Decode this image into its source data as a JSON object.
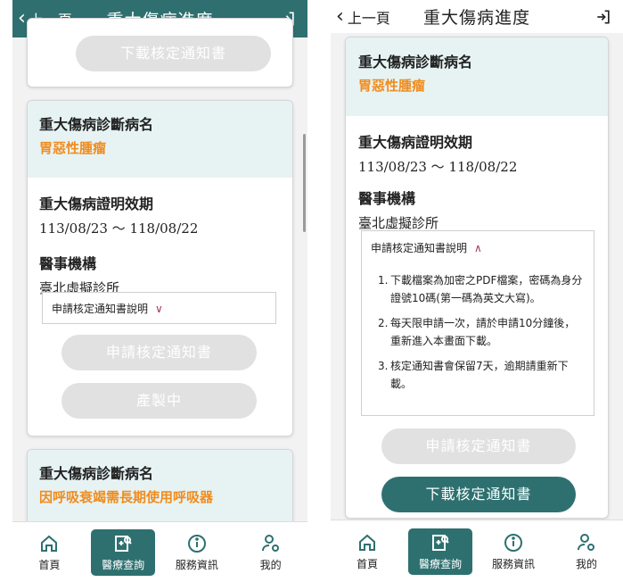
{
  "header": {
    "back_label": "上一頁",
    "title": "重大傷病進度"
  },
  "labels": {
    "diag_label": "重大傷病診斷病名",
    "valid_label": "重大傷病證明效期",
    "hospital_label": "醫事機構"
  },
  "left": {
    "top_button": "下載核定通知書",
    "card2": {
      "diagnosis": "胃惡性腫瘤",
      "valid_period": "113/08/23 ～ 118/08/22",
      "hospital": "臺北虛擬診所",
      "explain_toggle": "申請核定通知書說明",
      "apply_button": "申請核定通知書",
      "producing_button": "產製中"
    },
    "card3": {
      "diagnosis": "因呼吸衰竭需長期使用呼吸器"
    }
  },
  "right": {
    "card": {
      "diagnosis": "胃惡性腫瘤",
      "valid_period": "113/08/23 ～ 118/08/22",
      "hospital": "臺北虛擬診所",
      "explain_toggle": "申請核定通知書說明",
      "notes": [
        "下載檔案為加密之PDF檔案，密碼為身分證號10碼(第一碼為英文大寫)。",
        "每天限申請一次，請於申請10分鐘後，重新進入本畫面下載。",
        "核定通知書會保留7天，逾期請重新下載。"
      ],
      "apply_button": "申請核定通知書",
      "download_button": "下載核定通知書"
    }
  },
  "tabs": [
    {
      "label": "首頁",
      "icon": "home-icon"
    },
    {
      "label": "醫療查詢",
      "icon": "medical-search-icon"
    },
    {
      "label": "服務資訊",
      "icon": "info-icon"
    },
    {
      "label": "我的",
      "icon": "user-settings-icon"
    }
  ],
  "colors": {
    "brand": "#2e7070",
    "diagnosis": "#f08c1e",
    "card_head": "#e7f3f3",
    "disabled": "#e1e1e1"
  }
}
